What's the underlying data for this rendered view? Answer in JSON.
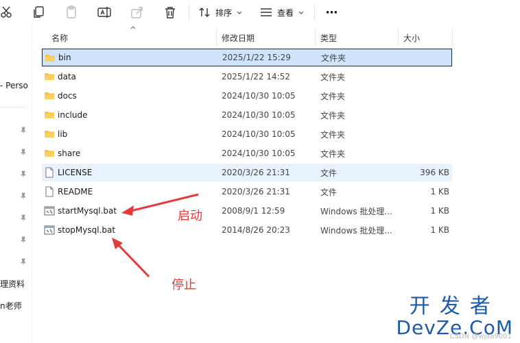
{
  "toolbar": {
    "sort_label": "排序",
    "view_label": "查看",
    "more_label": "···"
  },
  "sidebar": {
    "item_person": "- Perso",
    "item_docs": "理资料",
    "item_teacher": "n老师"
  },
  "columns": {
    "name": "名称",
    "modified": "修改日期",
    "type": "类型",
    "size": "大小"
  },
  "files": [
    {
      "name": "bin",
      "date": "2025/1/22 15:29",
      "type": "文件夹",
      "size": "",
      "kind": "folder"
    },
    {
      "name": "data",
      "date": "2025/1/22 14:52",
      "type": "文件夹",
      "size": "",
      "kind": "folder"
    },
    {
      "name": "docs",
      "date": "2024/10/30 10:05",
      "type": "文件夹",
      "size": "",
      "kind": "folder"
    },
    {
      "name": "include",
      "date": "2024/10/30 10:05",
      "type": "文件夹",
      "size": "",
      "kind": "folder"
    },
    {
      "name": "lib",
      "date": "2024/10/30 10:05",
      "type": "文件夹",
      "size": "",
      "kind": "folder"
    },
    {
      "name": "share",
      "date": "2024/10/30 10:05",
      "type": "文件夹",
      "size": "",
      "kind": "folder"
    },
    {
      "name": "LICENSE",
      "date": "2020/3/26 21:31",
      "type": "文件",
      "size": "396 KB",
      "kind": "file"
    },
    {
      "name": "README",
      "date": "2020/3/26 21:31",
      "type": "文件",
      "size": "1 KB",
      "kind": "file"
    },
    {
      "name": "startMysql.bat",
      "date": "2008/9/1 12:59",
      "type": "Windows 批处理...",
      "size": "1 KB",
      "kind": "bat"
    },
    {
      "name": "stopMysql.bat",
      "date": "2014/8/26 20:23",
      "type": "Windows 批处理...",
      "size": "1 KB",
      "kind": "bat"
    }
  ],
  "annotations": {
    "start": "启动",
    "stop": "停止"
  },
  "watermark": {
    "line1": "开发者",
    "line2": "DevZe.CoM",
    "line3": "CSDN @wjaa9001"
  },
  "colors": {
    "folder": "#f6c244",
    "selected_bg": "#cfe4fb",
    "annotation": "#e53a3a",
    "watermark": "#1d5aa8"
  }
}
